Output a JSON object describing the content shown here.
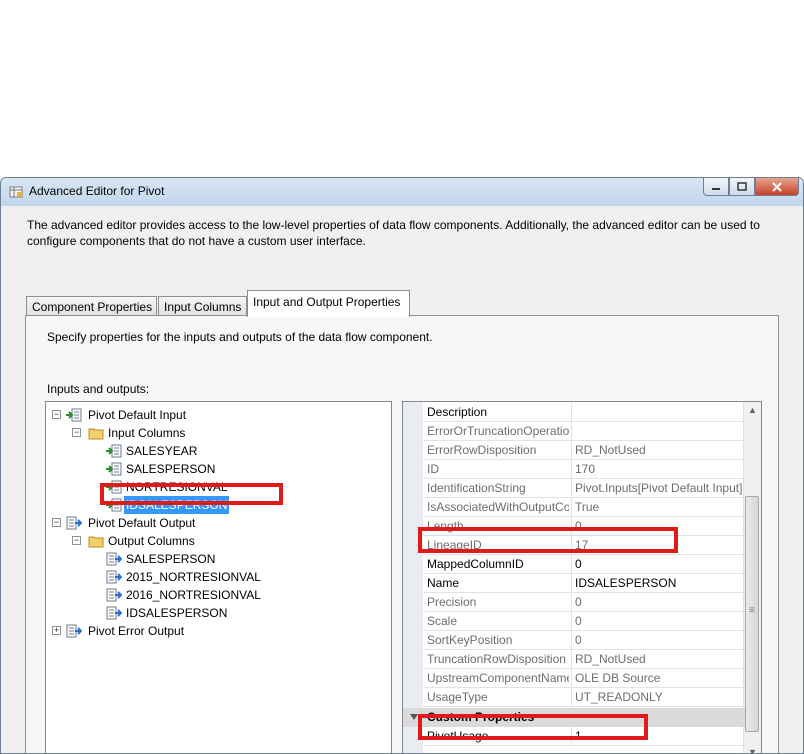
{
  "window": {
    "title": "Advanced Editor for Pivot",
    "description": "The advanced editor provides access to the low-level properties of data flow components. Additionally, the advanced editor can be used to configure components that do not have a custom user interface."
  },
  "tabs": [
    {
      "label": "Component Properties"
    },
    {
      "label": "Input Columns"
    },
    {
      "label": "Input and Output Properties"
    }
  ],
  "panel": {
    "description": "Specify properties for the inputs and outputs of the data flow component.",
    "io_label": "Inputs and outputs:"
  },
  "tree": [
    {
      "label": "Pivot Default Input",
      "expander": "−",
      "icon": "input-icon"
    },
    {
      "label": "Input Columns",
      "expander": "−",
      "icon": "folder-icon"
    },
    {
      "label": "SALESYEAR",
      "icon": "input-column-icon"
    },
    {
      "label": "SALESPERSON",
      "icon": "input-column-icon"
    },
    {
      "label": "NORTRESIONVAL",
      "icon": "input-column-icon"
    },
    {
      "label": "IDSALESPERSON",
      "icon": "input-column-icon",
      "selected": true
    },
    {
      "label": "Pivot Default Output",
      "expander": "−",
      "icon": "output-icon"
    },
    {
      "label": "Output Columns",
      "expander": "−",
      "icon": "folder-icon"
    },
    {
      "label": "SALESPERSON",
      "icon": "output-column-icon"
    },
    {
      "label": "2015_NORTRESIONVAL",
      "icon": "output-column-icon"
    },
    {
      "label": "2016_NORTRESIONVAL",
      "icon": "output-column-icon"
    },
    {
      "label": "IDSALESPERSON",
      "icon": "output-column-icon"
    },
    {
      "label": "Pivot Error Output",
      "expander": "+",
      "icon": "output-icon"
    }
  ],
  "properties": [
    {
      "name": "Description",
      "value": "",
      "enabled": true
    },
    {
      "name": "ErrorOrTruncationOperation",
      "value": "",
      "enabled": false
    },
    {
      "name": "ErrorRowDisposition",
      "value": "RD_NotUsed",
      "enabled": false
    },
    {
      "name": "ID",
      "value": "170",
      "enabled": false
    },
    {
      "name": "IdentificationString",
      "value": "Pivot.Inputs[Pivot Default Input]",
      "enabled": false
    },
    {
      "name": "IsAssociatedWithOutputColumn",
      "value": "True",
      "enabled": false
    },
    {
      "name": "Length",
      "value": "0",
      "enabled": false
    },
    {
      "name": "LineageID",
      "value": "17",
      "enabled": false
    },
    {
      "name": "MappedColumnID",
      "value": "0",
      "enabled": true
    },
    {
      "name": "Name",
      "value": "IDSALESPERSON",
      "enabled": true
    },
    {
      "name": "Precision",
      "value": "0",
      "enabled": false
    },
    {
      "name": "Scale",
      "value": "0",
      "enabled": false
    },
    {
      "name": "SortKeyPosition",
      "value": "0",
      "enabled": false
    },
    {
      "name": "TruncationRowDisposition",
      "value": "RD_NotUsed",
      "enabled": false
    },
    {
      "name": "UpstreamComponentName",
      "value": "OLE DB Source",
      "enabled": false
    },
    {
      "name": "UsageType",
      "value": "UT_READONLY",
      "enabled": false
    }
  ],
  "custom_category": "Custom Properties",
  "custom_properties": [
    {
      "name": "PivotUsage",
      "value": "1",
      "enabled": true
    }
  ],
  "colors": {
    "highlight": "#e0191b",
    "selection": "#3399ff"
  }
}
